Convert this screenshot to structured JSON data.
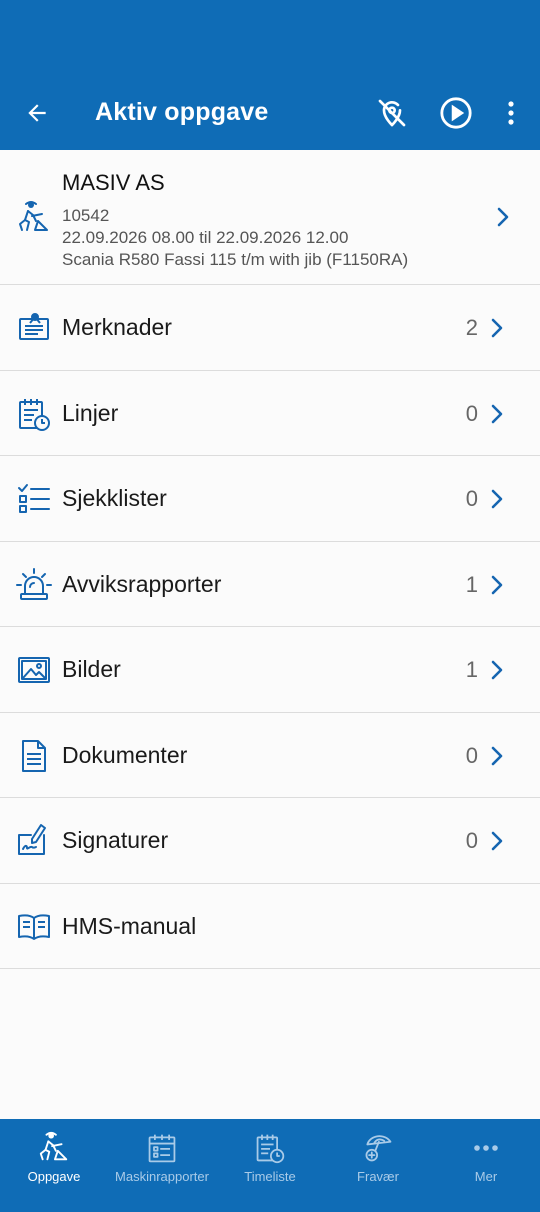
{
  "app_bar": {
    "title": "Aktiv oppgave",
    "back_icon": "arrow-back-icon",
    "actions": [
      "location-off-icon",
      "play-circle-icon",
      "more-vert-icon"
    ]
  },
  "task": {
    "customer": "MASIV AS",
    "number": "10542",
    "period": "22.09.2026 08.00 til 22.09.2026 12.00",
    "machine": "Scania R580 Fassi 115 t/m with jib (F1150RA)",
    "icon": "worker-digging-icon"
  },
  "items": [
    {
      "label": "Merknader",
      "count": "2",
      "icon": "note-board-icon"
    },
    {
      "label": "Linjer",
      "count": "0",
      "icon": "calendar-clock-icon"
    },
    {
      "label": "Sjekklister",
      "count": "0",
      "icon": "checklist-icon"
    },
    {
      "label": "Avviksrapporter",
      "count": "1",
      "icon": "alarm-siren-icon"
    },
    {
      "label": "Bilder",
      "count": "1",
      "icon": "image-icon"
    },
    {
      "label": "Dokumenter",
      "count": "0",
      "icon": "document-icon"
    },
    {
      "label": "Signaturer",
      "count": "0",
      "icon": "signature-icon"
    },
    {
      "label": "HMS-manual",
      "count": "",
      "icon": "open-book-icon"
    }
  ],
  "bottom_nav": [
    {
      "label": "Oppgave",
      "icon": "worker-digging-icon",
      "active": true
    },
    {
      "label": "Maskinrapporter",
      "icon": "calendar-report-icon",
      "active": false
    },
    {
      "label": "Timeliste",
      "icon": "timesheet-icon",
      "active": false
    },
    {
      "label": "Fravær",
      "icon": "beach-umbrella-icon",
      "active": false
    },
    {
      "label": "Mer",
      "icon": "more-horiz-icon",
      "active": false
    }
  ],
  "colors": {
    "primary": "#0f6cb6",
    "icon_blue": "#1565b0",
    "nav_inactive": "#a9cbe8",
    "divider": "#dcdcdc"
  }
}
